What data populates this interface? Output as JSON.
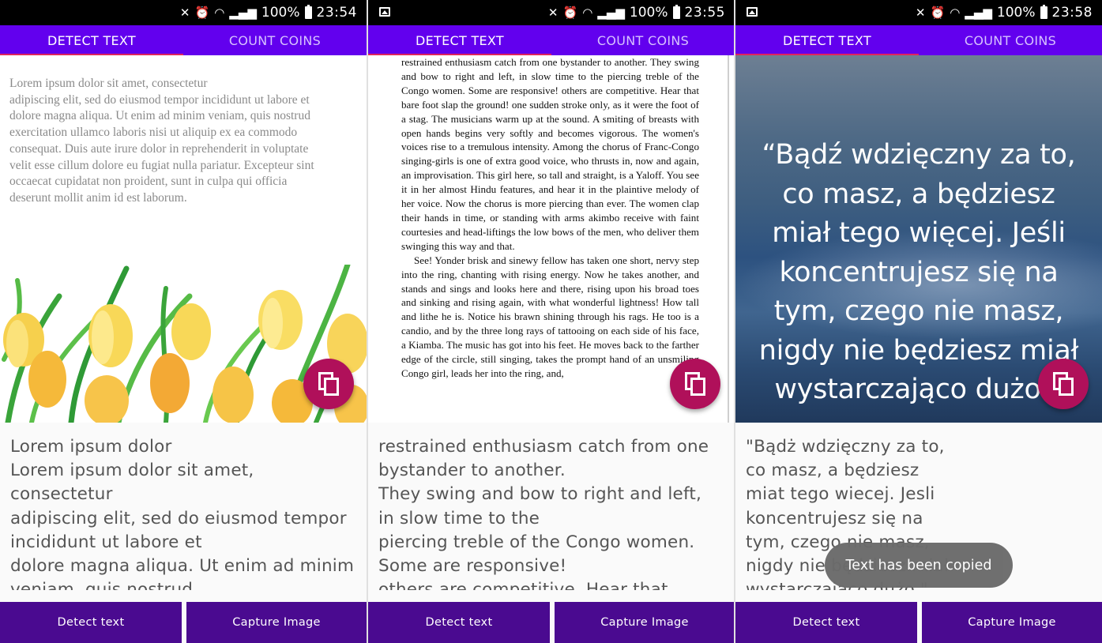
{
  "colors": {
    "toolbar": "#6200ee",
    "indicator": "#e0245e",
    "fab": "#b0105a",
    "bottom_button": "#4a0a90",
    "toast": "#6b6b6b"
  },
  "screens": [
    {
      "status": {
        "battery": "100%",
        "time": "23:54",
        "show_gallery_icon": false
      },
      "tabs": [
        {
          "label": "DETECT TEXT",
          "active": true
        },
        {
          "label": "COUNT COINS",
          "active": false
        }
      ],
      "image": {
        "text_lines": [
          "Lorem ipsum dolor sit amet, consectetur",
          "adipiscing elit, sed do eiusmod tempor incididunt ut labore et",
          "dolore magna aliqua. Ut enim ad minim veniam, quis nostrud",
          "exercitation ullamco laboris nisi ut aliquip ex ea commodo",
          "consequat. Duis aute irure dolor in reprehenderit in voluptate",
          "velit esse cillum dolore eu fugiat nulla pariatur. Excepteur sint",
          "occaecat cupidatat non proident, sunt in culpa qui officia",
          "deserunt mollit anim id est laborum."
        ]
      },
      "fab_icon": "copy-icon",
      "result_lines": [
        "Lorem ipsum dolor",
        "Lorem ipsum dolor sit amet,",
        "consectetur",
        "adipiscing elit, sed do eiusmod tempor",
        "incididunt ut labore et",
        "dolore magna aliqua. Ut enim ad minim",
        "veniam, quis nostrud"
      ],
      "buttons": {
        "detect": "Detect text",
        "capture": "Capture Image"
      }
    },
    {
      "status": {
        "battery": "100%",
        "time": "23:55",
        "show_gallery_icon": true
      },
      "tabs": [
        {
          "label": "DETECT TEXT",
          "active": true
        },
        {
          "label": "COUNT COINS",
          "active": false
        }
      ],
      "image": {
        "paragraphs": [
          "restrained enthusiasm catch from one bystander to another. They swing and bow to right and left, in slow time to the piercing treble of the Congo women. Some are responsive! others are competitive. Hear that bare foot slap the ground! one sudden stroke only, as it were the foot of a stag. The musicians warm up at the sound. A smiting of breasts with open hands begins very softly and becomes vigorous. The women's voices rise to a tremulous intensity. Among the chorus of Franc-Congo singing-girls is one of extra good voice, who thrusts in, now and again, an improvisation. This girl here, so tall and straight, is a Yaloff. You see it in her almost Hindu features, and hear it in the plaintive melody of her voice. Now the chorus is more piercing than ever. The women clap their hands in time, or standing with arms akimbo receive with faint courtesies and head-liftings the low bows of the men, who deliver them swinging this way and that.",
          "See! Yonder brisk and sinewy fellow has taken one short, nervy step into the ring, chanting with rising energy. Now he takes another, and stands and sings and looks here and there, rising upon his broad toes and sinking and rising again, with what wonderful lightness! How tall and lithe he is. Notice his brawn shining through his rags. He too is a candio, and by the three long rays of tattooing on each side of his face, a Kiamba. The music has got into his feet. He moves back to the farther edge of the circle, still singing, takes the prompt hand of an unsmiling Congo girl, leads her into the ring, and,"
        ]
      },
      "fab_icon": "copy-icon",
      "result_lines": [
        "restrained enthusiasm catch from one",
        "bystander to another.",
        "They swing and bow to right and left,",
        "in slow time to the",
        "piercing treble of the Congo women.",
        "Some are responsive!",
        "others are competitive. Hear that"
      ],
      "buttons": {
        "detect": "Detect text",
        "capture": "Capture Image"
      }
    },
    {
      "status": {
        "battery": "100%",
        "time": "23:58",
        "show_gallery_icon": true
      },
      "tabs": [
        {
          "label": "DETECT TEXT",
          "active": true
        },
        {
          "label": "COUNT COINS",
          "active": false
        }
      ],
      "image": {
        "quote_lines": [
          "“Bądź wdzięczny za to,",
          "co masz, a będziesz",
          "miał tego więcej. Jeśli",
          "koncentrujesz się na",
          "tym, czego nie masz,",
          "nigdy nie będziesz miał",
          "wystarczająco dużo.”"
        ]
      },
      "fab_icon": "copy-icon",
      "result_lines": [
        "\"Bądż wdzięczny za to,",
        "co masz, a będziesz",
        "miat tego wiecej. Jesli",
        "koncentrujesz się na",
        "tym, czego nie masz,",
        "nigdy nie będziesz miał",
        "wystarczająco dużo.\""
      ],
      "toast": "Text has been copied",
      "buttons": {
        "detect": "Detect text",
        "capture": "Capture Image"
      }
    }
  ]
}
